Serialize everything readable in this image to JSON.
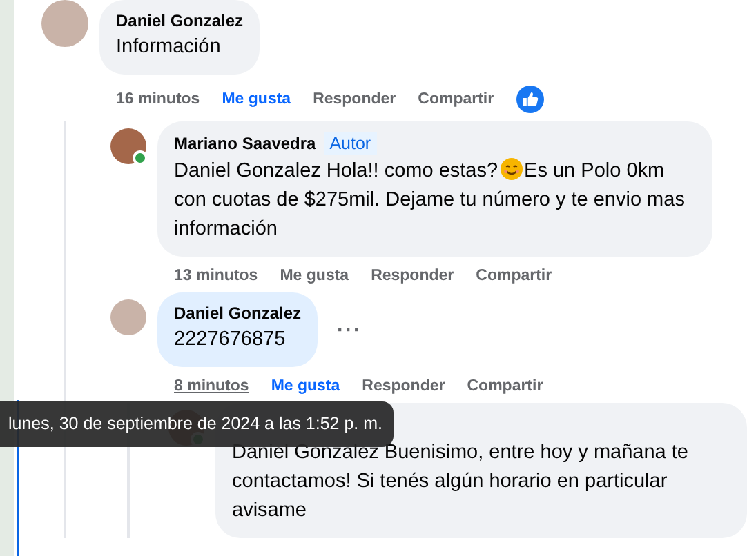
{
  "comments": [
    {
      "author": "Daniel Gonzalez",
      "body": [
        {
          "kind": "text",
          "value": "Información"
        }
      ],
      "time": "16 minutos",
      "like": {
        "label": "Me gusta",
        "selected": true
      },
      "actions": [
        "Responder",
        "Compartir"
      ],
      "reactions": [
        {
          "kind": "like"
        }
      ],
      "children": [
        {
          "author": "Mariano Saavedra",
          "badge": "Autor",
          "online": true,
          "body": [
            {
              "kind": "text",
              "value": "Daniel Gonzalez Hola!! como estas?"
            },
            {
              "kind": "emoji"
            },
            {
              "kind": "text",
              "value": "Es un Polo 0km con cuotas de $275mil. Dejame tu número y te envio mas información"
            }
          ],
          "time": "13 minutos",
          "like": {
            "label": "Me gusta",
            "selected": false
          },
          "actions": [
            "Responder",
            "Compartir"
          ]
        },
        {
          "author": "Daniel Gonzalez",
          "own": true,
          "body": [
            {
              "kind": "text",
              "value": "2227676875"
            }
          ],
          "time": "8 minutos",
          "time_hovered": true,
          "like": {
            "label": "Me gusta",
            "selected": true
          },
          "actions": [
            "Responder",
            "Compartir"
          ],
          "more_menu": "···",
          "children": [
            {
              "online": true,
              "header_covered": true,
              "body": [
                {
                  "kind": "text",
                  "value": "Daniel Gonzalez Buenisimo, entre hoy y mañana te contactamos! Si tenés algún horario en particular avisame"
                }
              ]
            }
          ]
        }
      ]
    }
  ],
  "tooltip": "lunes, 30 de septiembre de 2024 a las 1:52 p. m."
}
